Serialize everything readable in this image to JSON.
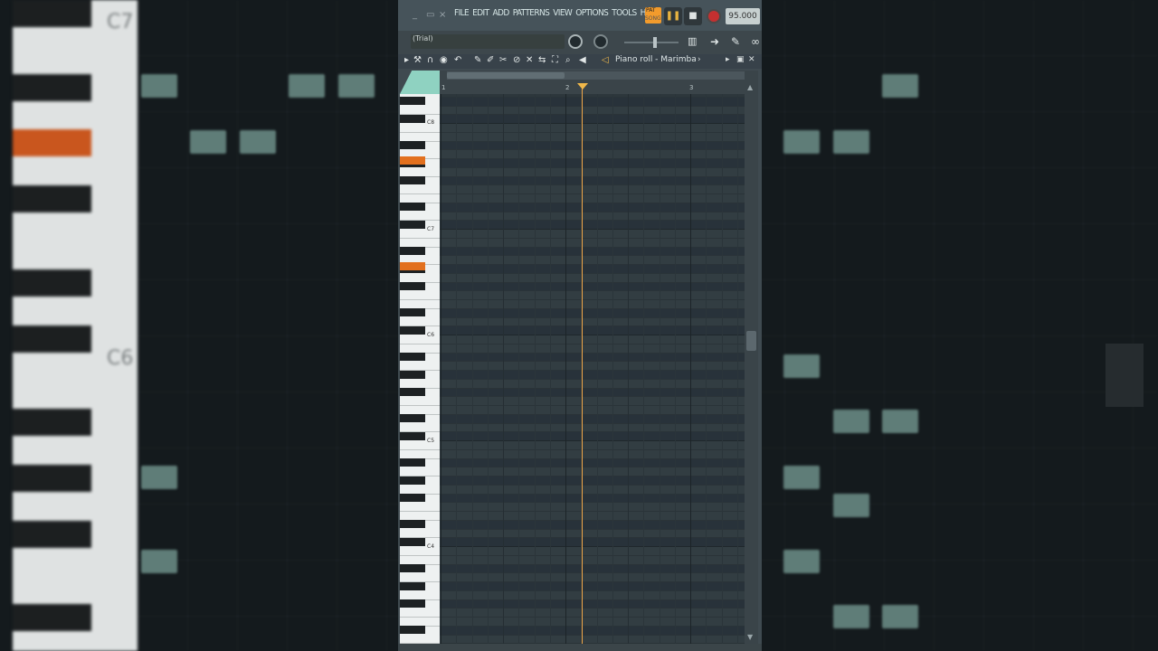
{
  "menubar": {
    "win_minimize": "_",
    "win_restore": "▭",
    "win_close": "×",
    "items": [
      "FILE",
      "EDIT",
      "ADD",
      "PATTERNS",
      "VIEW",
      "OPTIONS",
      "TOOLS",
      "HELP"
    ],
    "pat_label": "PAT",
    "song_label": "SONG",
    "pause_glyph": "❚❚",
    "stop_glyph": "■",
    "tempo": "95.000"
  },
  "toolbar": {
    "hint_text": "(Trial)"
  },
  "piano_roll": {
    "title": "Piano roll - Marimba",
    "title_arrow": "›",
    "bar_numbers": [
      "1",
      "2",
      "3"
    ],
    "octave_labels": [
      "C8",
      "C7",
      "C6",
      "C5",
      "C4"
    ]
  },
  "background": {
    "octave_labels": [
      "C7",
      "C6"
    ]
  },
  "colors": {
    "note": "#c9f1e4",
    "highlight_key": "#e2701e",
    "playhead": "#f2a94a"
  }
}
